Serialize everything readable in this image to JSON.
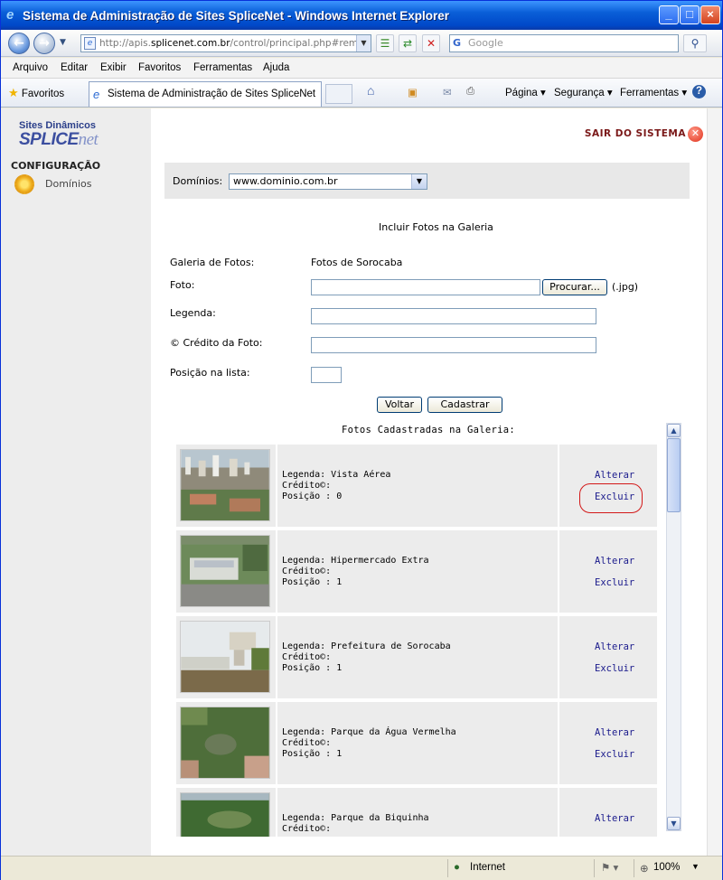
{
  "window": {
    "title": "Sistema de Administração de Sites SpliceNet - Windows Internet Explorer",
    "minimize": "_",
    "maximize": "□",
    "close": "×"
  },
  "address": {
    "url_prefix": "http://apis.",
    "url_domain": "splicenet.com.br",
    "url_rest": "/control/principal.php#remote",
    "search_placeholder": "Google"
  },
  "menu": [
    "Arquivo",
    "Editar",
    "Exibir",
    "Favoritos",
    "Ferramentas",
    "Ajuda"
  ],
  "favbar": {
    "favorites_label": "Favoritos",
    "tab_title": "Sistema de Administração de Sites SpliceNet",
    "commands": [
      "Página ▾",
      "Segurança ▾",
      "Ferramentas ▾"
    ]
  },
  "sidebar": {
    "logo_top": "Sites Dinâmicos",
    "logo_main": "SPLICE",
    "logo_script": "net",
    "section": "CONFIGURAÇÃO",
    "item": "Domínios"
  },
  "header": {
    "logout": "SAIR DO SISTEMA"
  },
  "domain": {
    "label": "Domínios:",
    "selected": "www.dominio.com.br"
  },
  "form": {
    "title": "Incluir Fotos na Galeria",
    "gallery_label": "Galeria de Fotos:",
    "gallery_value": "Fotos de Sorocaba",
    "photo_label": "Foto:",
    "browse_button": "Procurar...",
    "photo_ext": "(.jpg)",
    "caption_label": "Legenda:",
    "credit_label": "© Crédito da Foto:",
    "position_label": "Posição na lista:",
    "back_button": "Voltar",
    "submit_button": "Cadastrar"
  },
  "list": {
    "title": "Fotos Cadastradas na Galeria:",
    "edit_label": "Alterar",
    "delete_label": "Excluir",
    "rows": [
      {
        "caption": "Legenda: Vista Aérea",
        "credit": "Crédito©:",
        "position": "Posição : 0"
      },
      {
        "caption": "Legenda: Hipermercado Extra",
        "credit": "Crédito©:",
        "position": "Posição : 1"
      },
      {
        "caption": "Legenda: Prefeitura de Sorocaba",
        "credit": "Crédito©:",
        "position": "Posição : 1"
      },
      {
        "caption": "Legenda: Parque da Água Vermelha",
        "credit": "Crédito©:",
        "position": "Posição : 1"
      },
      {
        "caption": "Legenda: Parque da Biquinha",
        "credit": "Crédito©:",
        "position": ""
      }
    ]
  },
  "status": {
    "zone": "Internet",
    "zoom": "100%"
  }
}
